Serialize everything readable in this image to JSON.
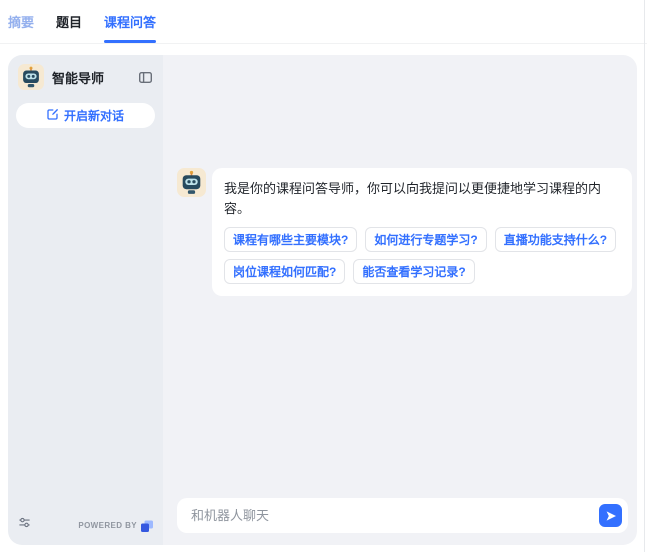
{
  "tabs": [
    {
      "label": "摘要"
    },
    {
      "label": "题目"
    },
    {
      "label": "课程问答"
    }
  ],
  "sidebar": {
    "title": "智能导师",
    "new_chat_label": "开启新对话",
    "powered_by": "POWERED BY"
  },
  "chat": {
    "welcome_message": "我是你的课程问答导师，你可以向我提问以更便捷地学习课程的内容。",
    "suggestions": [
      "课程有哪些主要模块?",
      "如何进行专题学习?",
      "直播功能支持什么?",
      "岗位课程如何匹配?",
      "能否查看学习记录?"
    ],
    "input_placeholder": "和机器人聊天"
  },
  "colors": {
    "accent": "#3370ff",
    "sidebar_bg": "#eaedf2",
    "chat_bg": "#f1f2f6",
    "inactive_tab": "#1f2329",
    "muted_tab": "#94b0ee"
  }
}
